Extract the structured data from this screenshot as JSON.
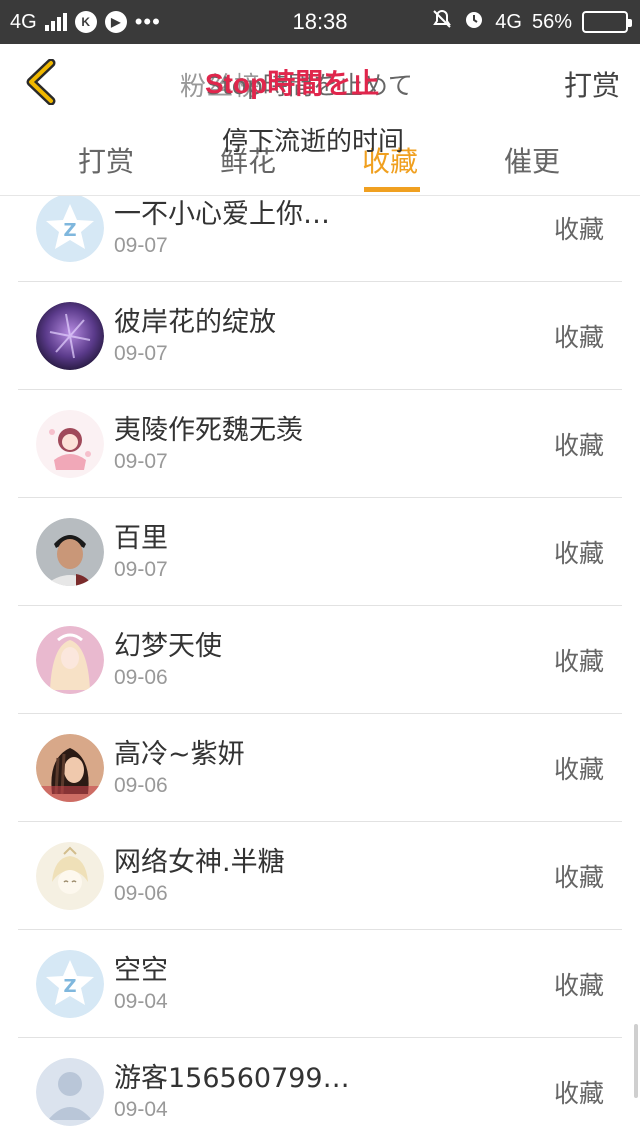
{
  "status_bar": {
    "network_left": "4G",
    "time": "18:38",
    "network_right": "4G",
    "battery_percent_label": "56%",
    "battery_level": 0.56,
    "icons": [
      "signal-icon",
      "app-badge-icon",
      "play-icon",
      "more-dots-icon",
      "mute-icon",
      "alarm-icon",
      "battery-icon"
    ]
  },
  "header": {
    "title_grey": "粉丝榜",
    "title_japanese": "Stop時間を止めて",
    "title_red": "Stop時間を止",
    "right_action": "打赏",
    "back_icon": "chevron-left-icon",
    "accent_color": "#f0a020",
    "title_red_color": "#e0264c"
  },
  "subtitle": "停下流逝的时间",
  "tabs": [
    {
      "label": "打赏",
      "active": false
    },
    {
      "label": "鲜花",
      "active": false
    },
    {
      "label": "收藏",
      "active": true
    },
    {
      "label": "催更",
      "active": false
    }
  ],
  "rows": [
    {
      "name": "一不小心爱上你…",
      "date": "09-07",
      "action": "收藏",
      "avatar": "qzone-default-avatar"
    },
    {
      "name": "彼岸花的绽放",
      "date": "09-07",
      "action": "收藏",
      "avatar": "purple-flower-avatar"
    },
    {
      "name": "夷陵作死魏无羡",
      "date": "09-07",
      "action": "收藏",
      "avatar": "anime-girl-pink-avatar"
    },
    {
      "name": "百里",
      "date": "09-07",
      "action": "收藏",
      "avatar": "photo-boy-avatar"
    },
    {
      "name": "幻梦天使",
      "date": "09-06",
      "action": "收藏",
      "avatar": "anime-angel-avatar"
    },
    {
      "name": "高冷~紫妍",
      "date": "09-06",
      "action": "收藏",
      "avatar": "braided-girl-avatar"
    },
    {
      "name": "网络女神.半糖",
      "date": "09-06",
      "action": "收藏",
      "avatar": "sketch-girl-avatar"
    },
    {
      "name": "空空",
      "date": "09-04",
      "action": "收藏",
      "avatar": "qzone-default-avatar"
    },
    {
      "name": "游客156560799…",
      "date": "09-04",
      "action": "收藏",
      "avatar": "guest-silhouette-avatar"
    }
  ]
}
